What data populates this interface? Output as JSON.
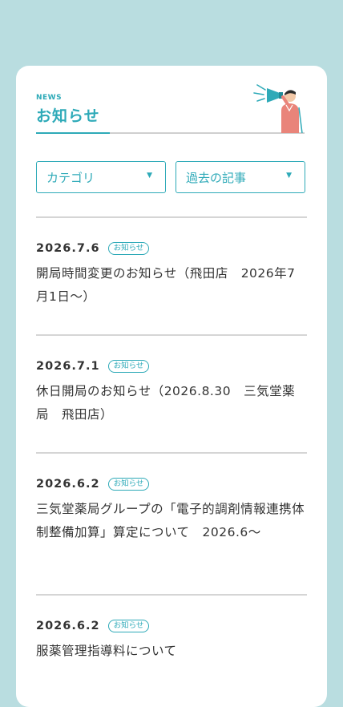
{
  "header": {
    "news_label": "NEWS",
    "title": "お知らせ"
  },
  "filters": {
    "category_label": "カテゴリ",
    "archive_label": "過去の記事",
    "caret": "▼"
  },
  "items": [
    {
      "date": "2026.7.6",
      "badge": "お知らせ",
      "title": "開局時間変更のお知らせ（飛田店　2026年7月1日～）"
    },
    {
      "date": "2026.7.1",
      "badge": "お知らせ",
      "title": "休日開局のお知らせ（2026.8.30　三気堂薬局　飛田店）"
    },
    {
      "date": "2026.6.2",
      "badge": "お知らせ",
      "title": "三気堂薬局グループの「電子的調剤情報連携体制整備加算」算定について　2026.6～"
    },
    {
      "date": "2026.6.2",
      "badge": "お知らせ",
      "title": "服薬管理指導料について"
    }
  ],
  "colors": {
    "background": "#b9dde0",
    "accent": "#2eaab8",
    "text": "#333333"
  }
}
